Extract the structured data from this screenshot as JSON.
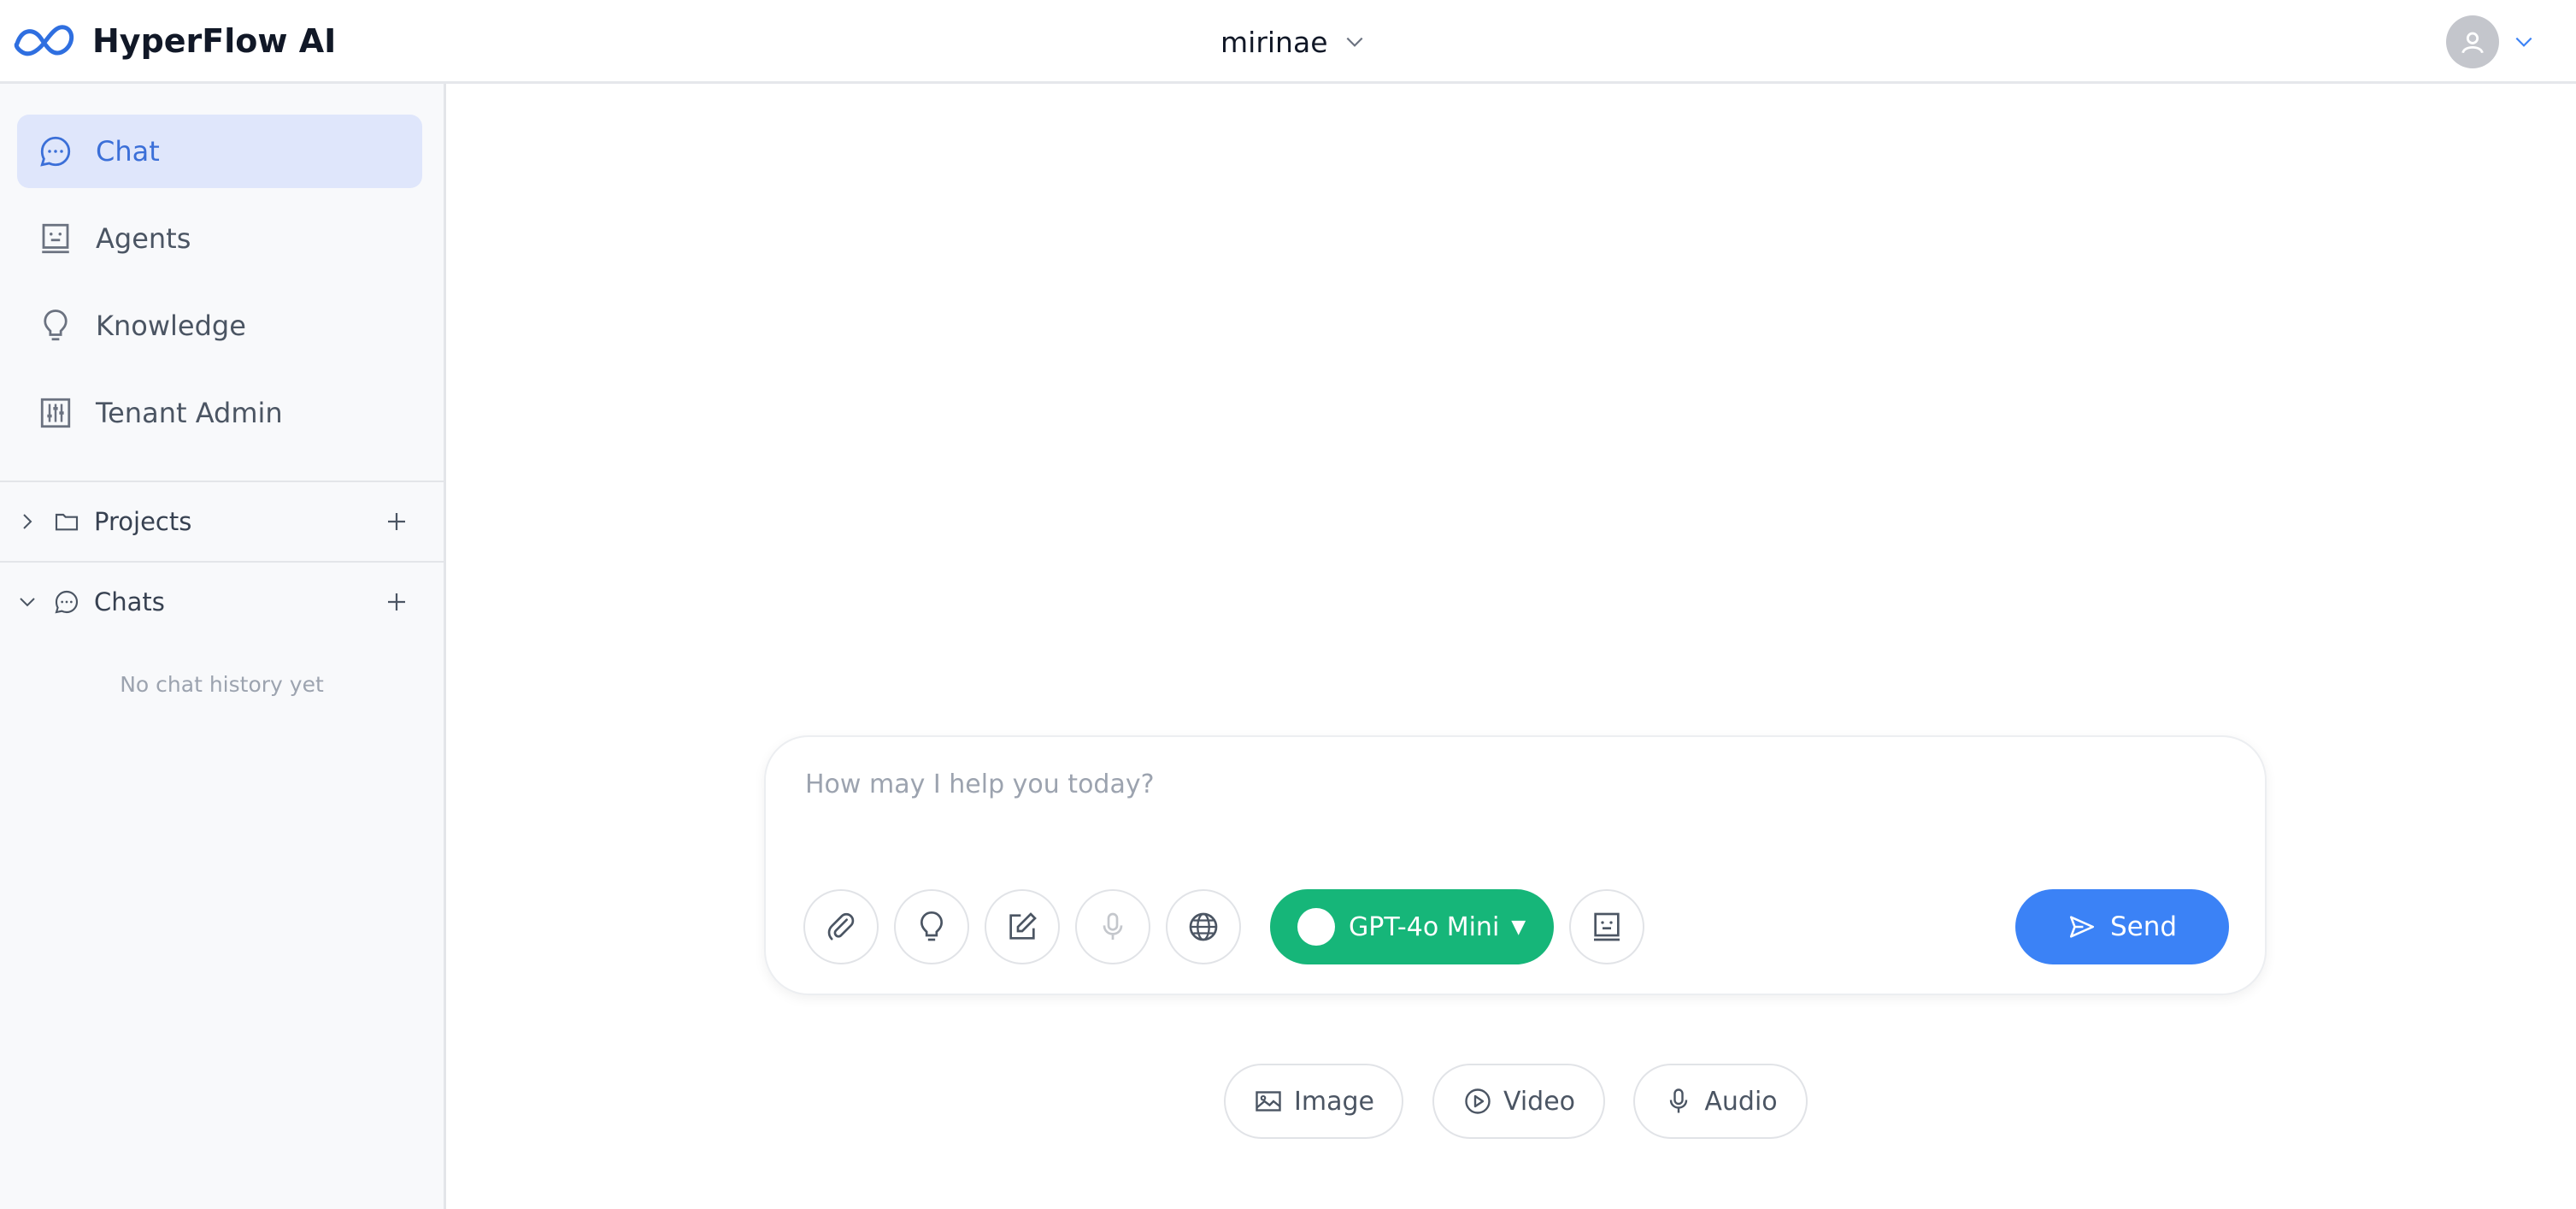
{
  "app": {
    "name": "HyperFlow AI"
  },
  "header": {
    "tenant_name": "mirinae"
  },
  "sidebar": {
    "nav": [
      {
        "label": "Chat",
        "icon": "chat-bubble-icon",
        "active": true
      },
      {
        "label": "Agents",
        "icon": "agent-icon",
        "active": false
      },
      {
        "label": "Knowledge",
        "icon": "lightbulb-icon",
        "active": false
      },
      {
        "label": "Tenant Admin",
        "icon": "sliders-icon",
        "active": false
      }
    ],
    "projects": {
      "label": "Projects",
      "expanded": false
    },
    "chats": {
      "label": "Chats",
      "expanded": true,
      "empty_text": "No chat history yet"
    }
  },
  "composer": {
    "placeholder": "How may I help you today?",
    "value": "",
    "tools": [
      "paperclip-icon",
      "lightbulb-icon",
      "edit-icon",
      "microphone-icon",
      "globe-icon",
      "agent-icon"
    ],
    "model": {
      "label": "GPT-4o Mini",
      "caret": "▼",
      "color": "#16b679"
    },
    "send_label": "Send"
  },
  "media": {
    "image_label": "Image",
    "video_label": "Video",
    "audio_label": "Audio"
  },
  "colors": {
    "accent": "#3b82f6",
    "model_green": "#16b679",
    "active_nav_bg": "#dfe6fb"
  }
}
